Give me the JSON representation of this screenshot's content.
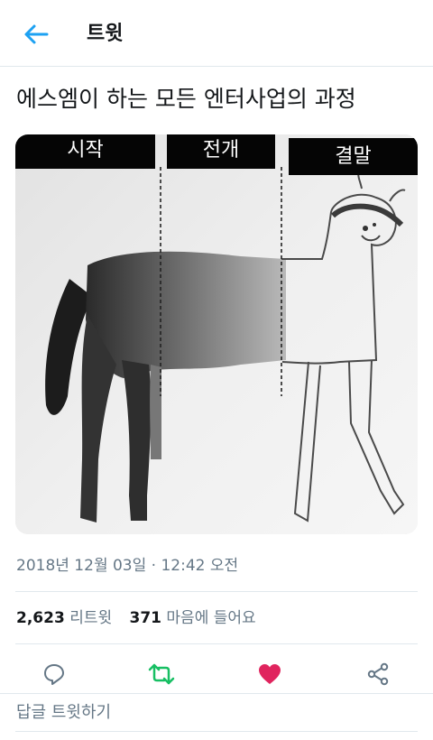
{
  "header": {
    "title": "트윗",
    "back_icon": "arrow-left-icon",
    "accent_color": "#1da1f2"
  },
  "tweet": {
    "text": "에스엠이 하는 모든 엔터사업의 과정",
    "media": {
      "panel_labels": [
        "시작",
        "전개",
        "결말"
      ],
      "description_icon": "horse-drawing-image"
    },
    "timestamp": "2018년 12월 03일 · 12:42 오전",
    "retweets": {
      "count": "2,623",
      "label": "리트윗"
    },
    "likes": {
      "count": "371",
      "label": "마음에 들어요"
    }
  },
  "actions": {
    "reply_icon": "reply-icon",
    "retweet_icon": "retweet-icon",
    "like_icon": "heart-icon",
    "share_icon": "share-icon",
    "retweet_color": "#17bf63",
    "like_color": "#e0245e"
  },
  "reply_bar": {
    "placeholder": "답글 트윗하기"
  }
}
